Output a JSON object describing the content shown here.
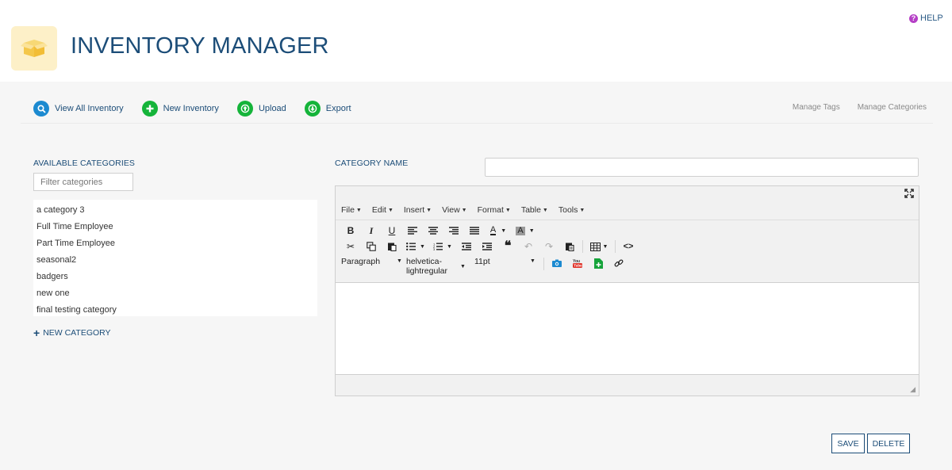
{
  "header": {
    "title": "INVENTORY MANAGER",
    "help_label": "HELP"
  },
  "toolbar": {
    "items": [
      {
        "label": "View All Inventory",
        "icon": "search-icon",
        "color": "#1c8ad0"
      },
      {
        "label": "New Inventory",
        "icon": "plus-icon",
        "color": "#15b43a"
      },
      {
        "label": "Upload",
        "icon": "upload-icon",
        "color": "#15b43a"
      },
      {
        "label": "Export",
        "icon": "download-icon",
        "color": "#15b43a"
      }
    ],
    "right_links": [
      "Manage Tags",
      "Manage Categories"
    ]
  },
  "categories": {
    "heading": "AVAILABLE CATEGORIES",
    "filter_placeholder": "Filter categories",
    "items": [
      "a category 3",
      "Full Time Employee",
      "Part Time Employee",
      "seasonal2",
      "badgers",
      "new one",
      "final testing category"
    ],
    "new_label": "NEW CATEGORY"
  },
  "form": {
    "name_label": "CATEGORY NAME",
    "name_value": ""
  },
  "editor": {
    "menus": [
      "File",
      "Edit",
      "Insert",
      "View",
      "Format",
      "Table",
      "Tools"
    ],
    "block_format": "Paragraph",
    "font_family_line1": "helvetica-",
    "font_family_line2": "lightregular",
    "font_size": "11pt",
    "content": ""
  },
  "actions": {
    "save": "SAVE",
    "delete": "DELETE"
  },
  "colors": {
    "brand": "#1c4d78",
    "primary_icon": "#1c8ad0",
    "success_icon": "#15b43a",
    "help_icon": "#b53fc6",
    "logo_bg": "#fdf0c8"
  }
}
